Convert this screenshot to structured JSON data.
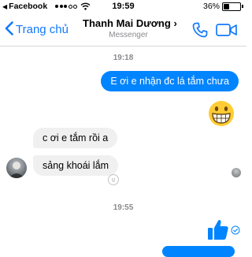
{
  "status_bar": {
    "back_app": "Facebook",
    "time": "19:59",
    "battery_percent": "36%",
    "battery_level": 0.36
  },
  "nav": {
    "back_label": "Trang chủ",
    "contact_name": "Thanh Mai Dương",
    "contact_chevron": "›",
    "subtitle": "Messenger"
  },
  "messages": {
    "stamp1": "19:18",
    "out1": "E ơi e nhận đc lá tắm chưa",
    "in1": "c ơi e tắm rồi a",
    "in2": "sảng khoái lắm",
    "stamp2": "19:55"
  },
  "icons": {
    "back": "chevron-left-icon",
    "phone": "phone-icon",
    "video": "video-camera-icon",
    "emoji": "grinning-emoji",
    "thumbs": "thumbs-up-icon",
    "seen": "check-circle-icon"
  },
  "colors": {
    "accent": "#1479fb",
    "bubble_out": "#0084ff",
    "bubble_in": "#f0f0f0",
    "emoji": "#ffcc33"
  }
}
